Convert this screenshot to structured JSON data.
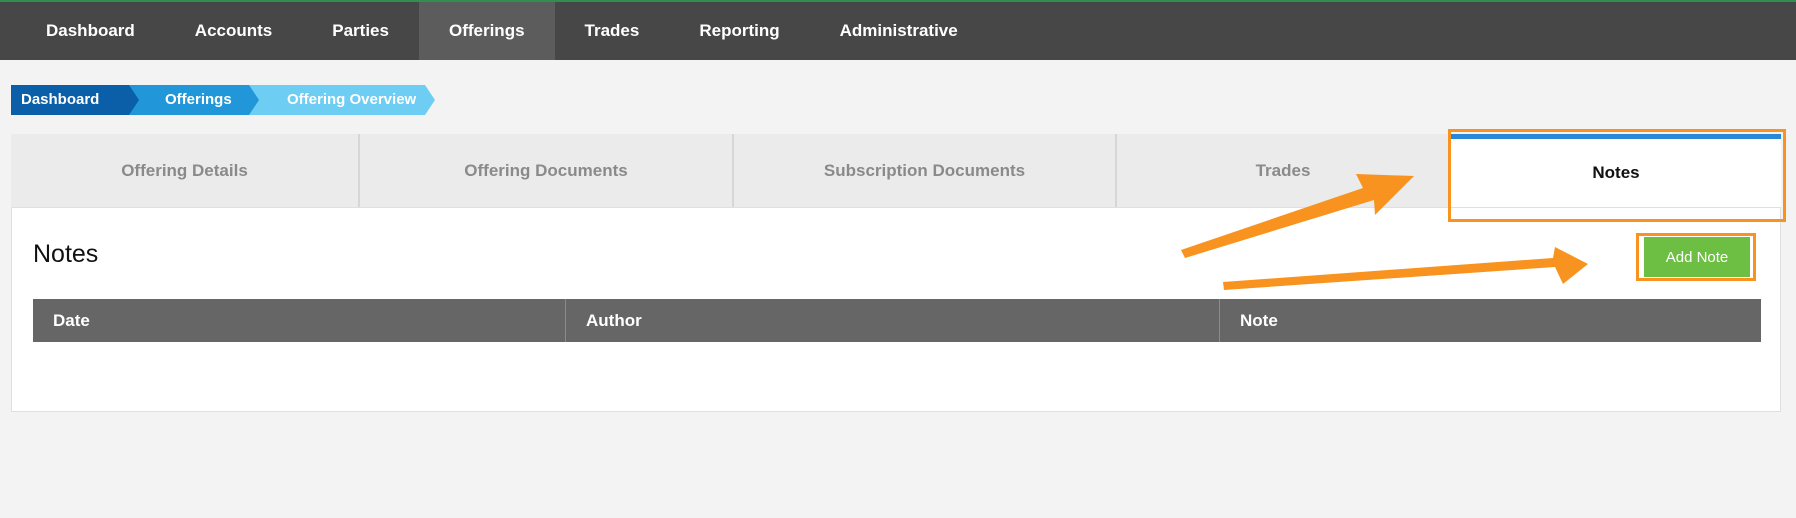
{
  "topnav": {
    "items": [
      {
        "label": "Dashboard"
      },
      {
        "label": "Accounts"
      },
      {
        "label": "Parties"
      },
      {
        "label": "Offerings",
        "active": true
      },
      {
        "label": "Trades"
      },
      {
        "label": "Reporting"
      },
      {
        "label": "Administrative"
      }
    ]
  },
  "breadcrumb": [
    "Dashboard",
    "Offerings",
    "Offering Overview"
  ],
  "tabs": [
    {
      "label": "Offering Details"
    },
    {
      "label": "Offering Documents"
    },
    {
      "label": "Subscription Documents"
    },
    {
      "label": "Trades"
    },
    {
      "label": "Notes",
      "active": true
    }
  ],
  "notes_panel": {
    "title": "Notes",
    "add_button": "Add Note",
    "columns": [
      "Date",
      "Author",
      "Note"
    ],
    "rows": []
  },
  "annotations": {
    "highlight_color": "#f7931e"
  }
}
